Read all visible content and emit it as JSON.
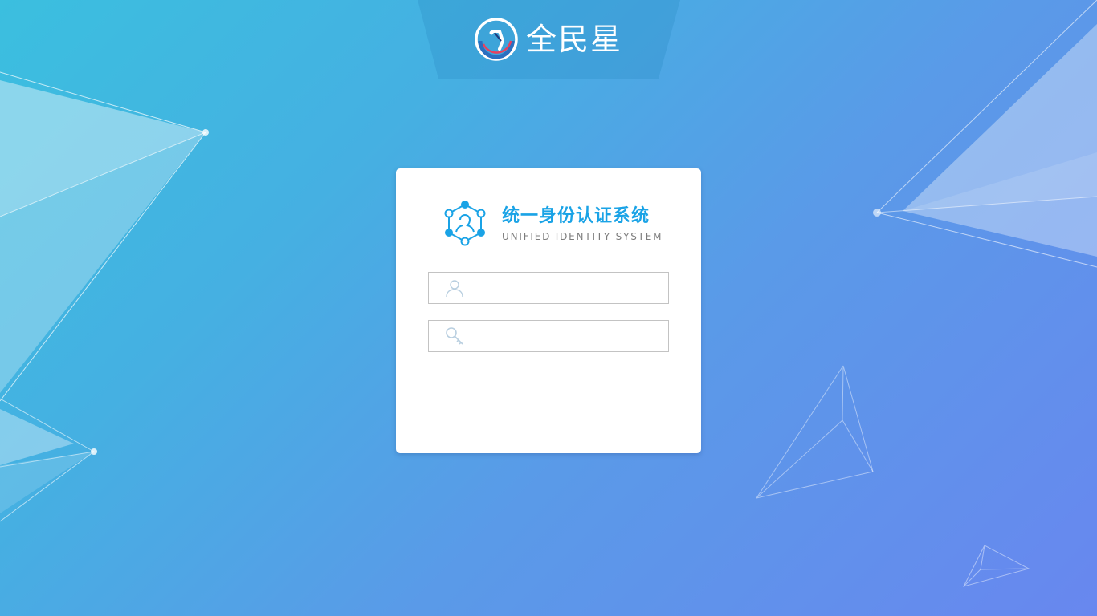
{
  "brand": {
    "name": "全民星",
    "logo_icon": "brand-swirl-logo"
  },
  "login": {
    "system_title": "统一身份认证系统",
    "system_subtitle": "UNIFIED IDENTITY SYSTEM",
    "system_icon": "identity-network-icon",
    "username": {
      "icon": "user-icon",
      "value": "",
      "placeholder": ""
    },
    "password": {
      "icon": "key-icon",
      "value": "",
      "placeholder": ""
    }
  },
  "colors": {
    "background_start": "#3bbfdf",
    "background_end": "#6887ef",
    "accent": "#1aa3e6",
    "card": "#ffffff",
    "field_border": "#c3c3c3"
  }
}
